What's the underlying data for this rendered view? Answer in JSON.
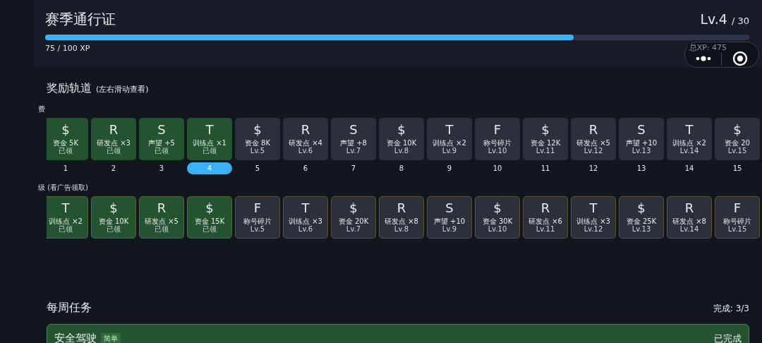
{
  "header": {
    "title": "赛季通行证",
    "level": "Lv.4",
    "level_max": "/ 30",
    "xp_bar": {
      "level": 0.75
    },
    "xp_text": "75 / 100 XP",
    "total_xp": "总XP: 475"
  },
  "track": {
    "title": "奖励轨道",
    "hint": "(左右滑动查看)",
    "free": {
      "label": "费",
      "items": [
        {
          "icon": "$",
          "label": "资金 5K",
          "status": "已领",
          "claimed": true,
          "number": "1",
          "selected": false
        },
        {
          "icon": "R",
          "label": "研发点 ×3",
          "status": "已领",
          "claimed": true,
          "number": "2",
          "selected": false
        },
        {
          "icon": "S",
          "label": "声望 +5",
          "status": "已领",
          "claimed": true,
          "number": "3",
          "selected": false
        },
        {
          "icon": "T",
          "label": "训练点 ×1",
          "status": "已领",
          "claimed": true,
          "number": "4",
          "selected": true
        },
        {
          "icon": "$",
          "label": "资金 8K",
          "status": "Lv.5",
          "claimed": false,
          "number": "5",
          "selected": false
        },
        {
          "icon": "R",
          "label": "研发点 ×4",
          "status": "Lv.6",
          "claimed": false,
          "number": "6",
          "selected": false
        },
        {
          "icon": "S",
          "label": "声望 +8",
          "status": "Lv.7",
          "claimed": false,
          "number": "7",
          "selected": false
        },
        {
          "icon": "$",
          "label": "资金 10K",
          "status": "Lv.8",
          "claimed": false,
          "number": "8",
          "selected": false
        },
        {
          "icon": "T",
          "label": "训练点 ×2",
          "status": "Lv.9",
          "claimed": false,
          "number": "9",
          "selected": false
        },
        {
          "icon": "F",
          "label": "称号碎片",
          "status": "Lv.10",
          "claimed": false,
          "number": "10",
          "selected": false
        },
        {
          "icon": "$",
          "label": "资金 12K",
          "status": "Lv.11",
          "claimed": false,
          "number": "11",
          "selected": false
        },
        {
          "icon": "R",
          "label": "研发点 ×5",
          "status": "Lv.12",
          "claimed": false,
          "number": "12",
          "selected": false
        },
        {
          "icon": "S",
          "label": "声望 +10",
          "status": "Lv.13",
          "claimed": false,
          "number": "13",
          "selected": false
        },
        {
          "icon": "T",
          "label": "训练点 ×2",
          "status": "Lv.14",
          "claimed": false,
          "number": "14",
          "selected": false
        },
        {
          "icon": "$",
          "label": "资金 20",
          "status": "Lv.15",
          "claimed": false,
          "number": "15",
          "selected": false
        }
      ]
    },
    "premium": {
      "label": "级 (看广告领取)",
      "items": [
        {
          "icon": "T",
          "label": "训练点 ×2",
          "status": "已领",
          "claimed": true
        },
        {
          "icon": "$",
          "label": "资金 10K",
          "status": "已领",
          "claimed": true
        },
        {
          "icon": "R",
          "label": "研发点 ×5",
          "status": "已领",
          "claimed": true
        },
        {
          "icon": "$",
          "label": "资金 15K",
          "status": "已领",
          "claimed": true
        },
        {
          "icon": "F",
          "label": "称号碎片",
          "status": "Lv.5",
          "claimed": false
        },
        {
          "icon": "T",
          "label": "训练点 ×3",
          "status": "Lv.6",
          "claimed": false
        },
        {
          "icon": "$",
          "label": "资金 20K",
          "status": "Lv.7",
          "claimed": false
        },
        {
          "icon": "R",
          "label": "研发点 ×8",
          "status": "Lv.8",
          "claimed": false
        },
        {
          "icon": "S",
          "label": "声望 +10",
          "status": "Lv.9",
          "claimed": false
        },
        {
          "icon": "$",
          "label": "资金 30K",
          "status": "Lv.10",
          "claimed": false
        },
        {
          "icon": "R",
          "label": "研发点 ×6",
          "status": "Lv.11",
          "claimed": false
        },
        {
          "icon": "T",
          "label": "训练点 ×3",
          "status": "Lv.12",
          "claimed": false
        },
        {
          "icon": "$",
          "label": "资金 25K",
          "status": "Lv.13",
          "claimed": false
        },
        {
          "icon": "R",
          "label": "研发点 ×8",
          "status": "Lv.14",
          "claimed": false
        },
        {
          "icon": "F",
          "label": "称号碎片",
          "status": "Lv.15",
          "claimed": false
        }
      ]
    }
  },
  "weekly": {
    "title": "每周任务",
    "progress": "完成: 3/3",
    "tasks": [
      {
        "name": "安全驾驶",
        "tag": "简单",
        "status": "已完成",
        "done": true
      }
    ]
  }
}
